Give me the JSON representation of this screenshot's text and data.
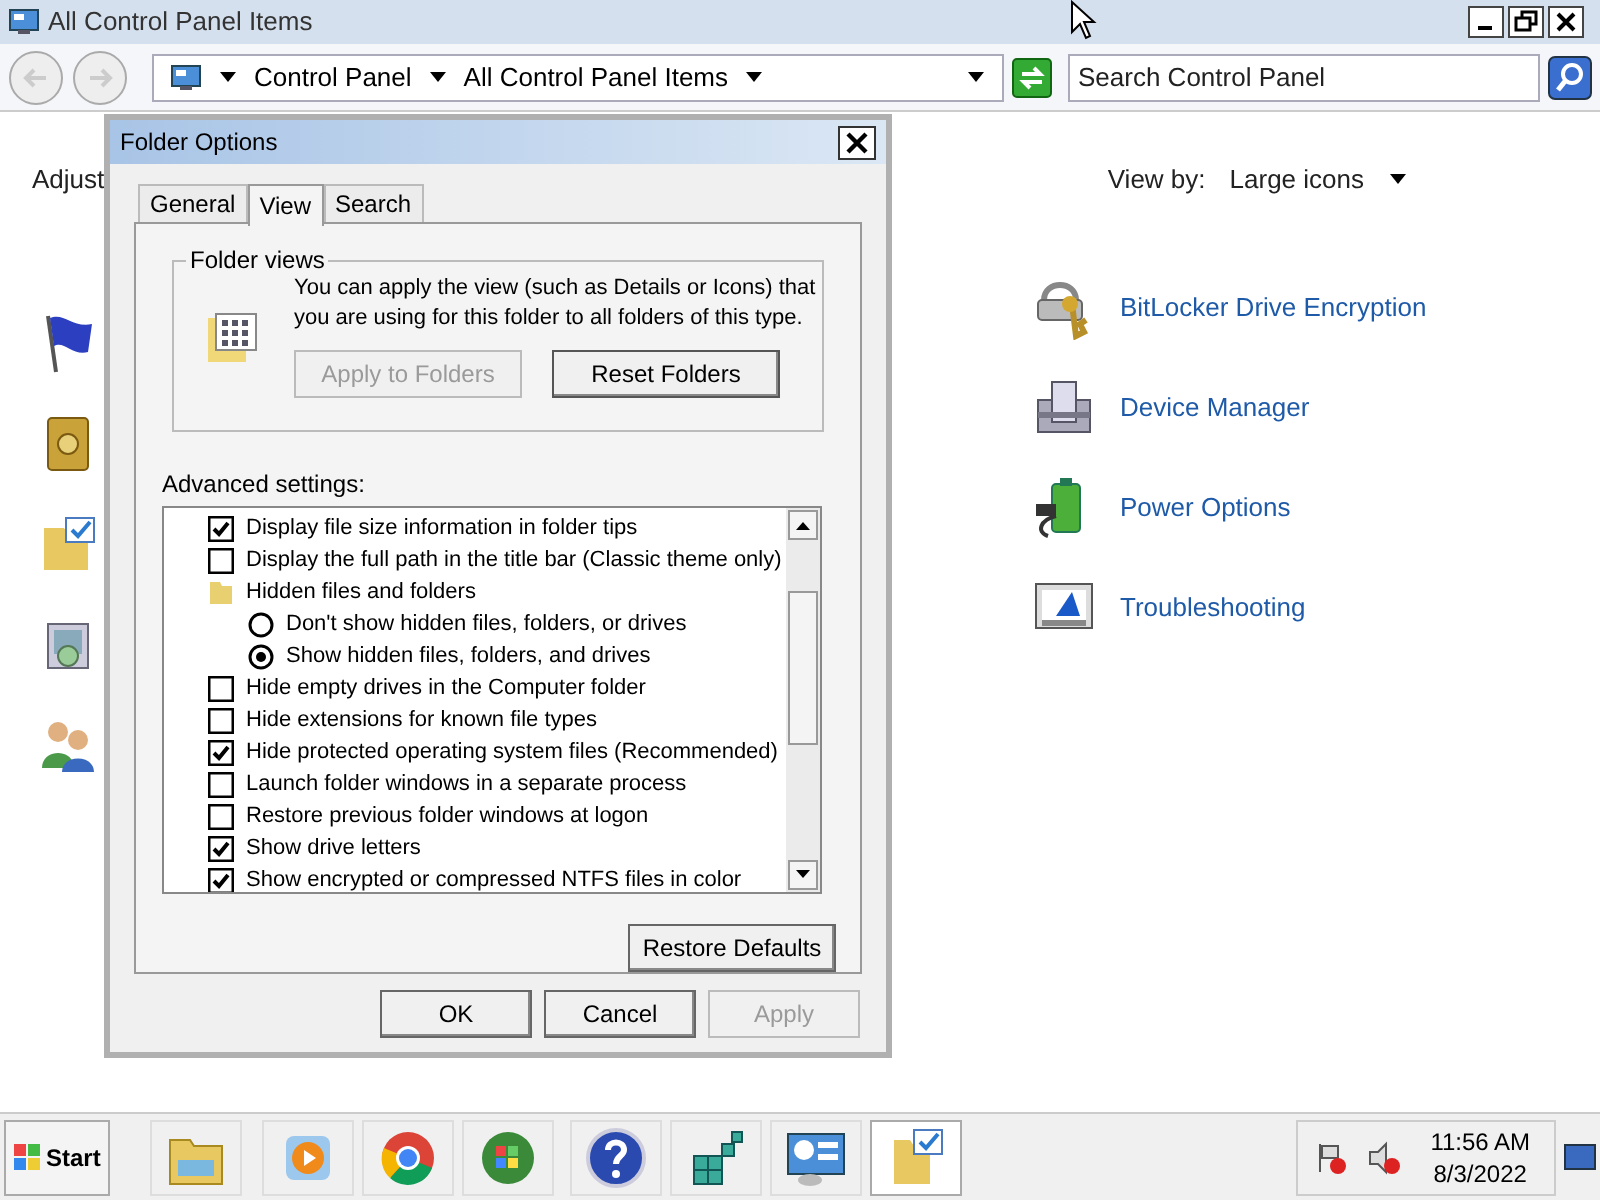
{
  "window": {
    "title": "All Control Panel Items",
    "breadcrumbs": [
      "Control Panel",
      "All Control Panel Items"
    ],
    "search": {
      "placeholder": "Search Control Panel"
    }
  },
  "content": {
    "heading": "Adjust",
    "view_by": {
      "label": "View by:",
      "value": "Large icons"
    },
    "items": [
      {
        "label": "BitLocker Drive Encryption"
      },
      {
        "label": "Device Manager"
      },
      {
        "label": "Power Options"
      },
      {
        "label": "Troubleshooting"
      }
    ]
  },
  "dialog": {
    "title": "Folder Options",
    "tabs": [
      {
        "label": "General",
        "selected": false
      },
      {
        "label": "View",
        "selected": true
      },
      {
        "label": "Search",
        "selected": false
      }
    ],
    "folder_views": {
      "legend": "Folder views",
      "description": "You can apply the view (such as Details or Icons) that you are using for this folder to all folders of this type.",
      "buttons": [
        {
          "label": "Apply to Folders",
          "disabled": true
        },
        {
          "label": "Reset Folders",
          "disabled": false
        }
      ]
    },
    "advanced_label": "Advanced settings:",
    "settings": [
      {
        "kind": "checkbox",
        "label": "Display file size information in folder tips",
        "checked": true
      },
      {
        "kind": "checkbox",
        "label": "Display the full path in the title bar (Classic theme only)",
        "checked": false
      },
      {
        "kind": "group",
        "label": "Hidden files and folders"
      },
      {
        "kind": "radio",
        "label": "Don't show hidden files, folders, or drives",
        "selected": false
      },
      {
        "kind": "radio",
        "label": "Show hidden files, folders, and drives",
        "selected": true
      },
      {
        "kind": "checkbox",
        "label": "Hide empty drives in the Computer folder",
        "checked": false
      },
      {
        "kind": "checkbox",
        "label": "Hide extensions for known file types",
        "checked": false
      },
      {
        "kind": "checkbox",
        "label": "Hide protected operating system files (Recommended)",
        "checked": true
      },
      {
        "kind": "checkbox",
        "label": "Launch folder windows in a separate process",
        "checked": false
      },
      {
        "kind": "checkbox",
        "label": "Restore previous folder windows at logon",
        "checked": false
      },
      {
        "kind": "checkbox",
        "label": "Show drive letters",
        "checked": true
      },
      {
        "kind": "checkbox",
        "label": "Show encrypted or compressed NTFS files in color",
        "checked": true
      }
    ],
    "restore_button": "Restore Defaults",
    "buttons": [
      {
        "label": "OK",
        "disabled": false
      },
      {
        "label": "Cancel",
        "disabled": false
      },
      {
        "label": "Apply",
        "disabled": true
      }
    ]
  },
  "taskbar": {
    "start": "Start",
    "items": [
      {
        "selected": false
      },
      {
        "selected": false
      },
      {
        "selected": false
      },
      {
        "selected": false
      },
      {
        "selected": false
      },
      {
        "selected": false
      },
      {
        "selected": false
      },
      {
        "selected": true
      }
    ],
    "time": "11:56 AM",
    "date": "8/3/2022"
  }
}
